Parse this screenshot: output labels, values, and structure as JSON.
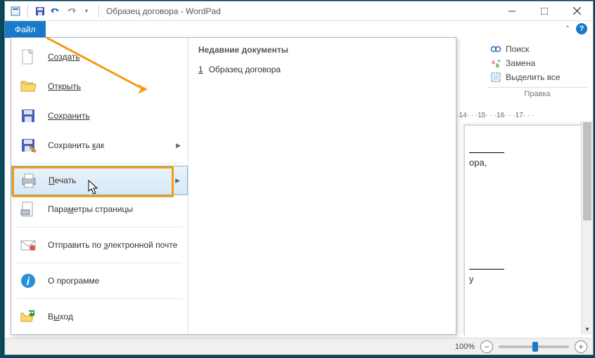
{
  "title": "Образец договора - WordPad",
  "file_tab": "Файл",
  "menu": {
    "create": "Создать",
    "open": "Открыть",
    "save": "Сохранить",
    "saveas_pre": "Сохранить ",
    "saveas_u": "к",
    "saveas_post": "ак",
    "print_u": "П",
    "print_post": "ечать",
    "pagesetup_pre": "Пара",
    "pagesetup_u": "м",
    "pagesetup_post": "етры страницы",
    "send_pre": "Отправить по ",
    "send_u": "э",
    "send_post": "лектронной почте",
    "about": "О программе",
    "exit_pre": "В",
    "exit_u": "ы",
    "exit_post": "ход"
  },
  "recent": {
    "title": "Недавние документы",
    "items": [
      {
        "num": "1",
        "label": "Образец договора"
      }
    ]
  },
  "side": {
    "search": "Поиск",
    "replace": "Замена",
    "selectall": "Выделить все",
    "group": "Правка"
  },
  "ruler": "· · ·14· · ·15· · ·16· · ·17· · ·",
  "doc": {
    "line1": "ора,",
    "line2": "у"
  },
  "status": {
    "zoom": "100%"
  }
}
